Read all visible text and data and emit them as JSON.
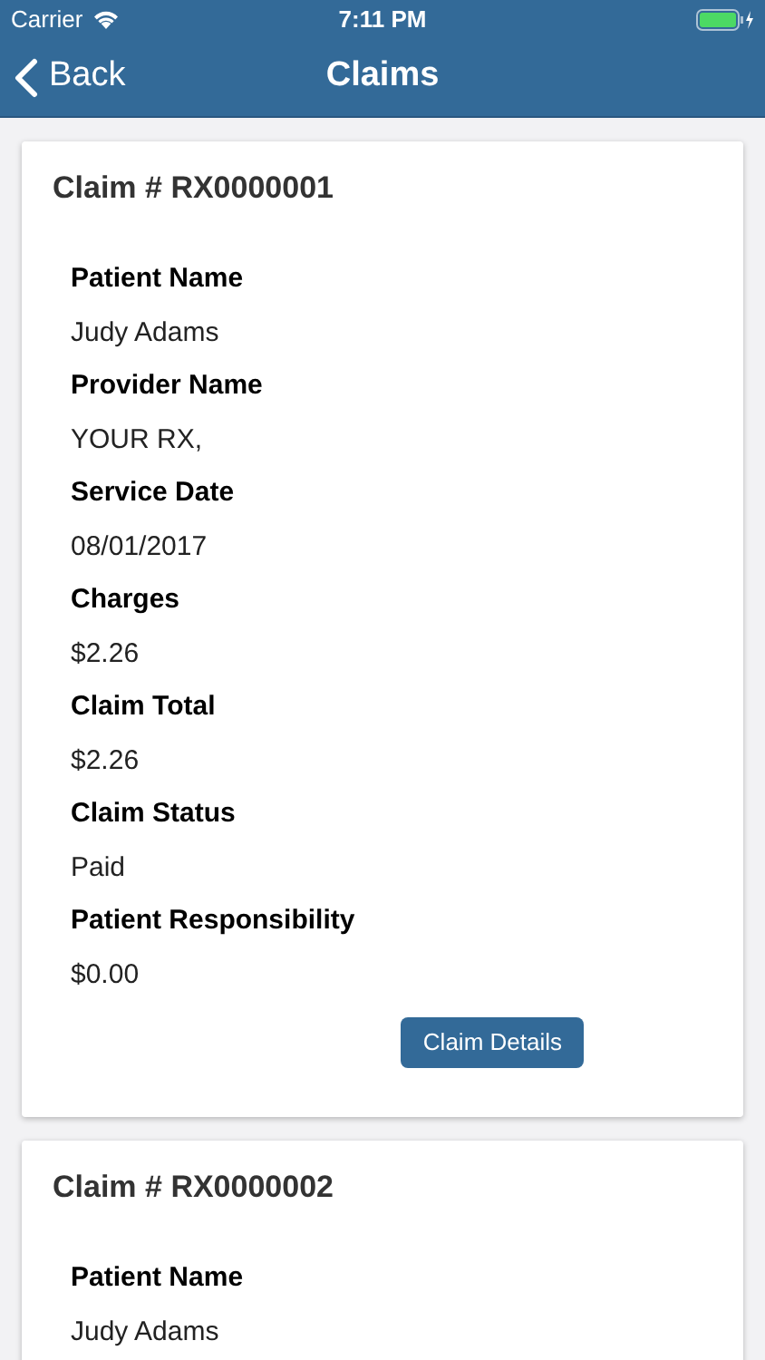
{
  "status_bar": {
    "carrier": "Carrier",
    "time": "7:11 PM"
  },
  "nav": {
    "back": "Back",
    "title": "Claims"
  },
  "claims": [
    {
      "title": "Claim # RX0000001",
      "fields": [
        {
          "label": "Patient Name",
          "value": "Judy Adams"
        },
        {
          "label": "Provider Name",
          "value": "YOUR RX,"
        },
        {
          "label": "Service Date",
          "value": "08/01/2017"
        },
        {
          "label": "Charges",
          "value": "$2.26"
        },
        {
          "label": "Claim Total",
          "value": "$2.26"
        },
        {
          "label": "Claim Status",
          "value": "Paid"
        },
        {
          "label": "Patient Responsibility",
          "value": "$0.00"
        }
      ],
      "button": "Claim Details"
    },
    {
      "title": "Claim # RX0000002",
      "fields": [
        {
          "label": "Patient Name",
          "value": "Judy Adams"
        }
      ]
    }
  ]
}
